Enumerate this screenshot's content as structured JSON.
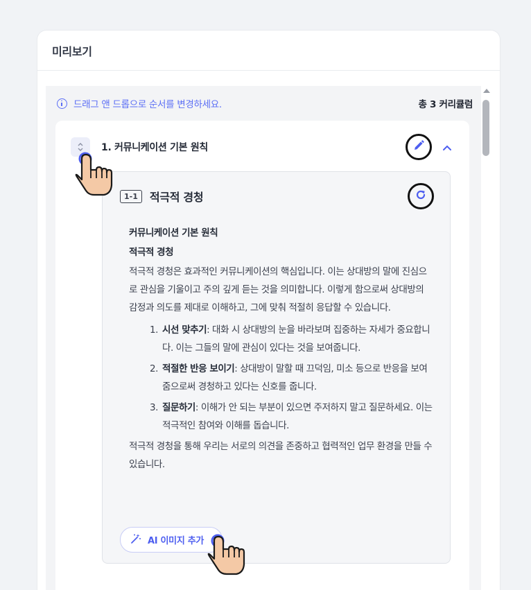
{
  "panel": {
    "title": "미리보기"
  },
  "preview": {
    "notice": "드래그 앤 드롭으로 순서를 변경하세요.",
    "count_prefix": "총 ",
    "count_num": "3",
    "count_suffix": " 커리큘럼"
  },
  "card": {
    "title": "1. 커뮤니케이션 기본 원칙",
    "icons": [
      "drag-handle-icon",
      "pencil-icon",
      "chevron-up-icon"
    ]
  },
  "lesson": {
    "number": "1-1",
    "title": "적극적 경청",
    "heading1": "커뮤니케이션 기본 원칙",
    "heading2": "적극적 경청",
    "intro": "적극적 경청은 효과적인 커뮤니케이션의 핵심입니다. 이는 상대방의 말에 진심으로 관심을 기울이고 주의 깊게 듣는 것을 의미합니다. 이렇게 함으로써 상대방의 감정과 의도를 제대로 이해하고, 그에 맞춰 적절히 응답할 수 있습니다.",
    "points": [
      {
        "n": "1.",
        "bold": "시선 맞추기",
        "text": ": 대화 시 상대방의 눈을 바라보며 집중하는 자세가 중요합니다. 이는 그들의 말에 관심이 있다는 것을 보여줍니다."
      },
      {
        "n": "2.",
        "bold": "적절한 반응 보이기",
        "text": ": 상대방이 말할 때 끄덕임, 미소 등으로 반응을 보여줌으로써 경청하고 있다는 신호를 줍니다."
      },
      {
        "n": "3.",
        "bold": "질문하기",
        "text": ": 이해가 안 되는 부분이 있으면 주저하지 말고 질문하세요. 이는 적극적인 참여와 이해를 돕습니다."
      }
    ],
    "outro": "적극적 경청을 통해 우리는 서로의 의견을 존중하고 협력적인 업무 환경을 만들 수 있습니다.",
    "ai_button": "AI 이미지 추가"
  },
  "colors": {
    "accent": "#4d5ef0",
    "notice": "#5b6ef5",
    "card_bg": "#ffffff",
    "lesson_bg": "#f5f6f8"
  }
}
